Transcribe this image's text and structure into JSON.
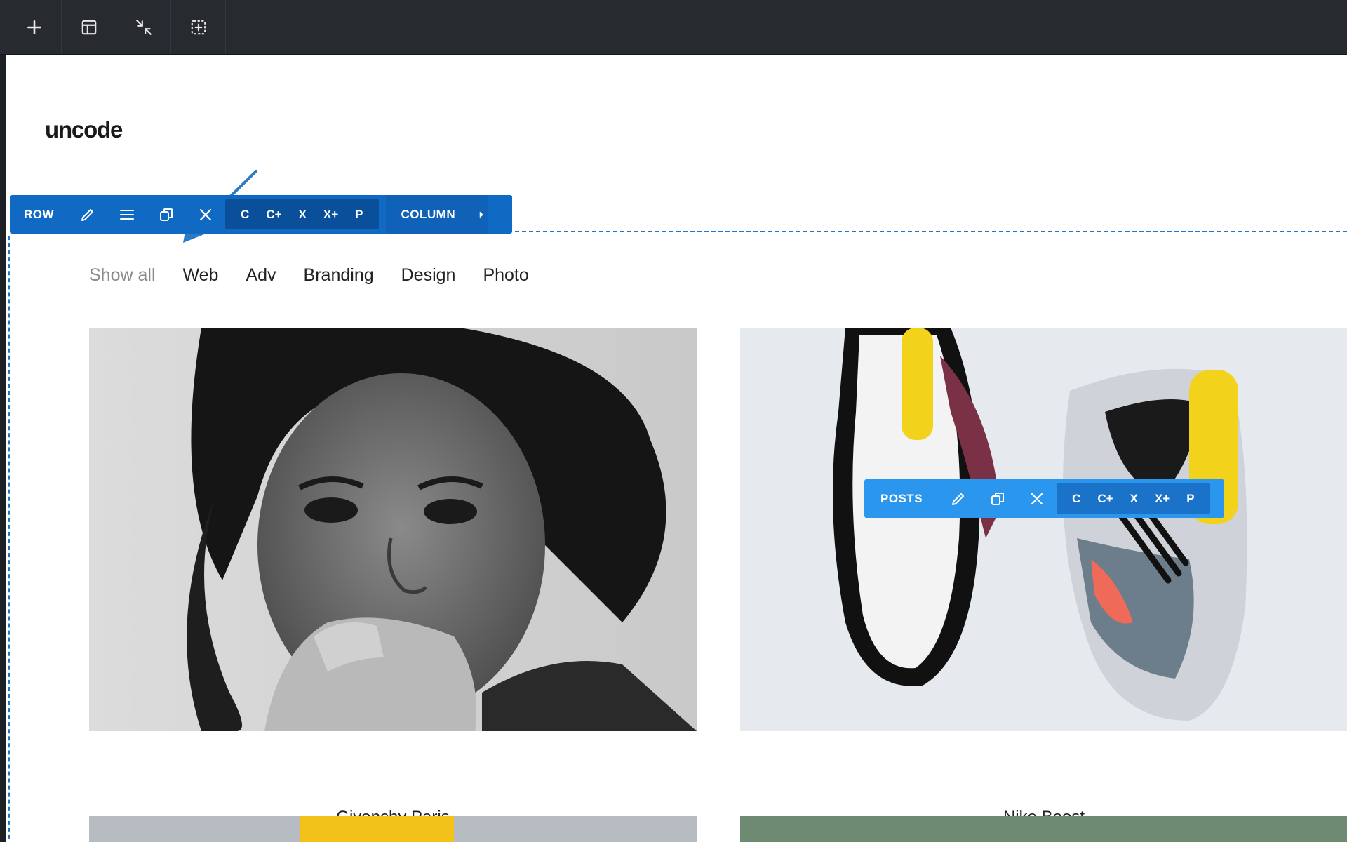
{
  "topbar": {
    "buttons": [
      {
        "icon": "plus-icon"
      },
      {
        "icon": "layout-template-icon"
      },
      {
        "icon": "collapse-arrows-icon"
      },
      {
        "icon": "add-element-icon"
      }
    ]
  },
  "site": {
    "logo": "uncode"
  },
  "row_toolbar": {
    "label": "ROW",
    "actions": [
      "edit-icon",
      "menu-icon",
      "duplicate-icon",
      "close-icon"
    ],
    "shortcuts": [
      "C",
      "C+",
      "X",
      "X+",
      "P"
    ],
    "column_label": "COLUMN"
  },
  "filters": [
    "Show all",
    "Web",
    "Adv",
    "Branding",
    "Design",
    "Photo"
  ],
  "posts_toolbar": {
    "label": "POSTS",
    "actions": [
      "edit-icon",
      "duplicate-icon",
      "close-icon"
    ],
    "shortcuts": [
      "C",
      "C+",
      "X",
      "X+",
      "P"
    ]
  },
  "portfolio": [
    {
      "title": "Givenchy Paris"
    },
    {
      "title": "Nike Boost"
    }
  ],
  "colors": {
    "accent": "#1069c2",
    "posts_accent": "#2b96ee",
    "topbar": "#272b30"
  }
}
